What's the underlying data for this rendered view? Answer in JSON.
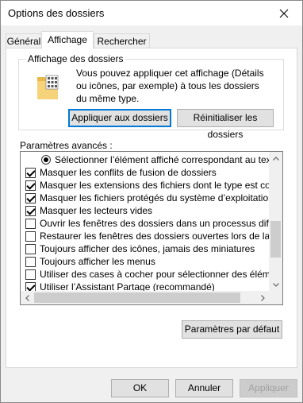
{
  "window": {
    "title": "Options des dossiers"
  },
  "tabs": [
    {
      "label": "Général"
    },
    {
      "label": "Affichage"
    },
    {
      "label": "Rechercher"
    }
  ],
  "folder_views": {
    "label": "Affichage des dossiers",
    "description": "Vous pouvez appliquer cet affichage (Détails ou icônes, par exemple) à tous les dossiers du même type.",
    "apply_label": "Appliquer aux dossiers",
    "reset_label": "Réinitialiser les dossiers"
  },
  "advanced": {
    "label": "Paramètres avancés :",
    "items": [
      {
        "type": "radio",
        "checked": true,
        "label": "Sélectionner l’élément affiché correspondant au texte saisi"
      },
      {
        "type": "checkbox",
        "checked": true,
        "label": "Masquer les conflits de fusion de dossiers"
      },
      {
        "type": "checkbox",
        "checked": true,
        "label": "Masquer les extensions des fichiers dont le type est connu"
      },
      {
        "type": "checkbox",
        "checked": true,
        "label": "Masquer les fichiers protégés du système d’exploitation (recommandé)"
      },
      {
        "type": "checkbox",
        "checked": true,
        "label": "Masquer les lecteurs vides"
      },
      {
        "type": "checkbox",
        "checked": false,
        "label": "Ouvrir les fenêtres des dossiers dans un processus différent"
      },
      {
        "type": "checkbox",
        "checked": false,
        "label": "Restaurer les fenêtres des dossiers ouvertes lors de la prochaine ouverture de session"
      },
      {
        "type": "checkbox",
        "checked": false,
        "label": "Toujours afficher des icônes, jamais des miniatures"
      },
      {
        "type": "checkbox",
        "checked": false,
        "label": "Toujours afficher les menus"
      },
      {
        "type": "checkbox",
        "checked": false,
        "label": "Utiliser des cases à cocher pour sélectionner des éléments"
      },
      {
        "type": "checkbox",
        "checked": true,
        "label": "Utiliser l’Assistant Partage (recommandé)"
      }
    ],
    "restore_defaults_label": "Paramètres par défaut"
  },
  "footer": {
    "ok_label": "OK",
    "cancel_label": "Annuler",
    "apply_label": "Appliquer"
  },
  "icons": {
    "close": "close-icon",
    "folder": "folder-options-icon",
    "scroll_up": "chevron-up-icon",
    "scroll_down": "chevron-down-icon",
    "scroll_left": "chevron-left-icon",
    "scroll_right": "chevron-right-icon"
  }
}
